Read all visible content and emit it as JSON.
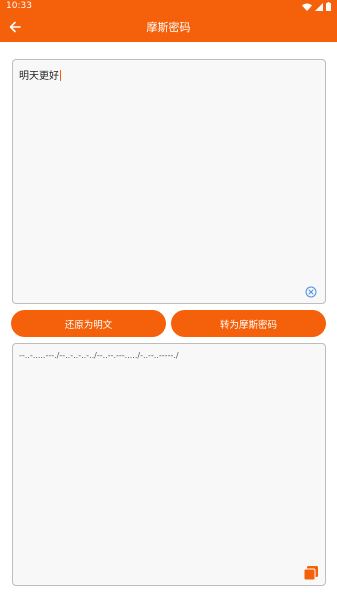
{
  "status": {
    "time": "10:33"
  },
  "appbar": {
    "title": "摩斯密码"
  },
  "input": {
    "value": "明天更好"
  },
  "actions": {
    "decode_label": "还原为明文",
    "encode_label": "转为摩斯密码"
  },
  "output": {
    "value": "--..-.....---./--..-..-..-../--..--.---...../-..--..-----./"
  },
  "colors": {
    "accent": "#f5600a",
    "card_bg": "#f8f8f8",
    "card_border": "#bdbdbd"
  },
  "icons": {
    "back": "arrow-left-icon",
    "clear": "clear-circle-icon",
    "copy": "copy-icon",
    "wifi": "wifi-icon",
    "signal": "signal-icon",
    "battery": "battery-icon"
  }
}
